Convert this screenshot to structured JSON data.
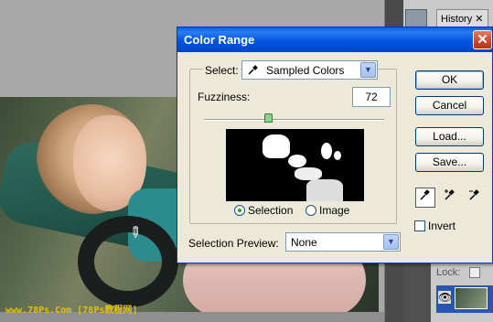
{
  "dialog": {
    "title": "Color Range",
    "close_label": "✕",
    "select_label": "Select:",
    "select_value": "Sampled Colors",
    "fuzziness_label": "Fuzziness:",
    "fuzziness_value": "72",
    "fuzziness_level_fraction": 0.36,
    "radio_selection": "Selection",
    "radio_image": "Image",
    "radio_selected": "Selection",
    "selection_preview_label": "Selection Preview:",
    "selection_preview_value": "None",
    "buttons": {
      "ok": "OK",
      "cancel": "Cancel",
      "load": "Load...",
      "save": "Save..."
    },
    "invert_label": "Invert",
    "invert_checked": false
  },
  "panel": {
    "tab_label": "History",
    "tab_close": "✕",
    "lock_label": "Lock:"
  },
  "watermark": "www.78Ps.Com [78Ps教程网]",
  "colors": {
    "titlebar": "#0054e3",
    "dialog_bg": "#ece9d8",
    "close_button": "#d0482a"
  }
}
